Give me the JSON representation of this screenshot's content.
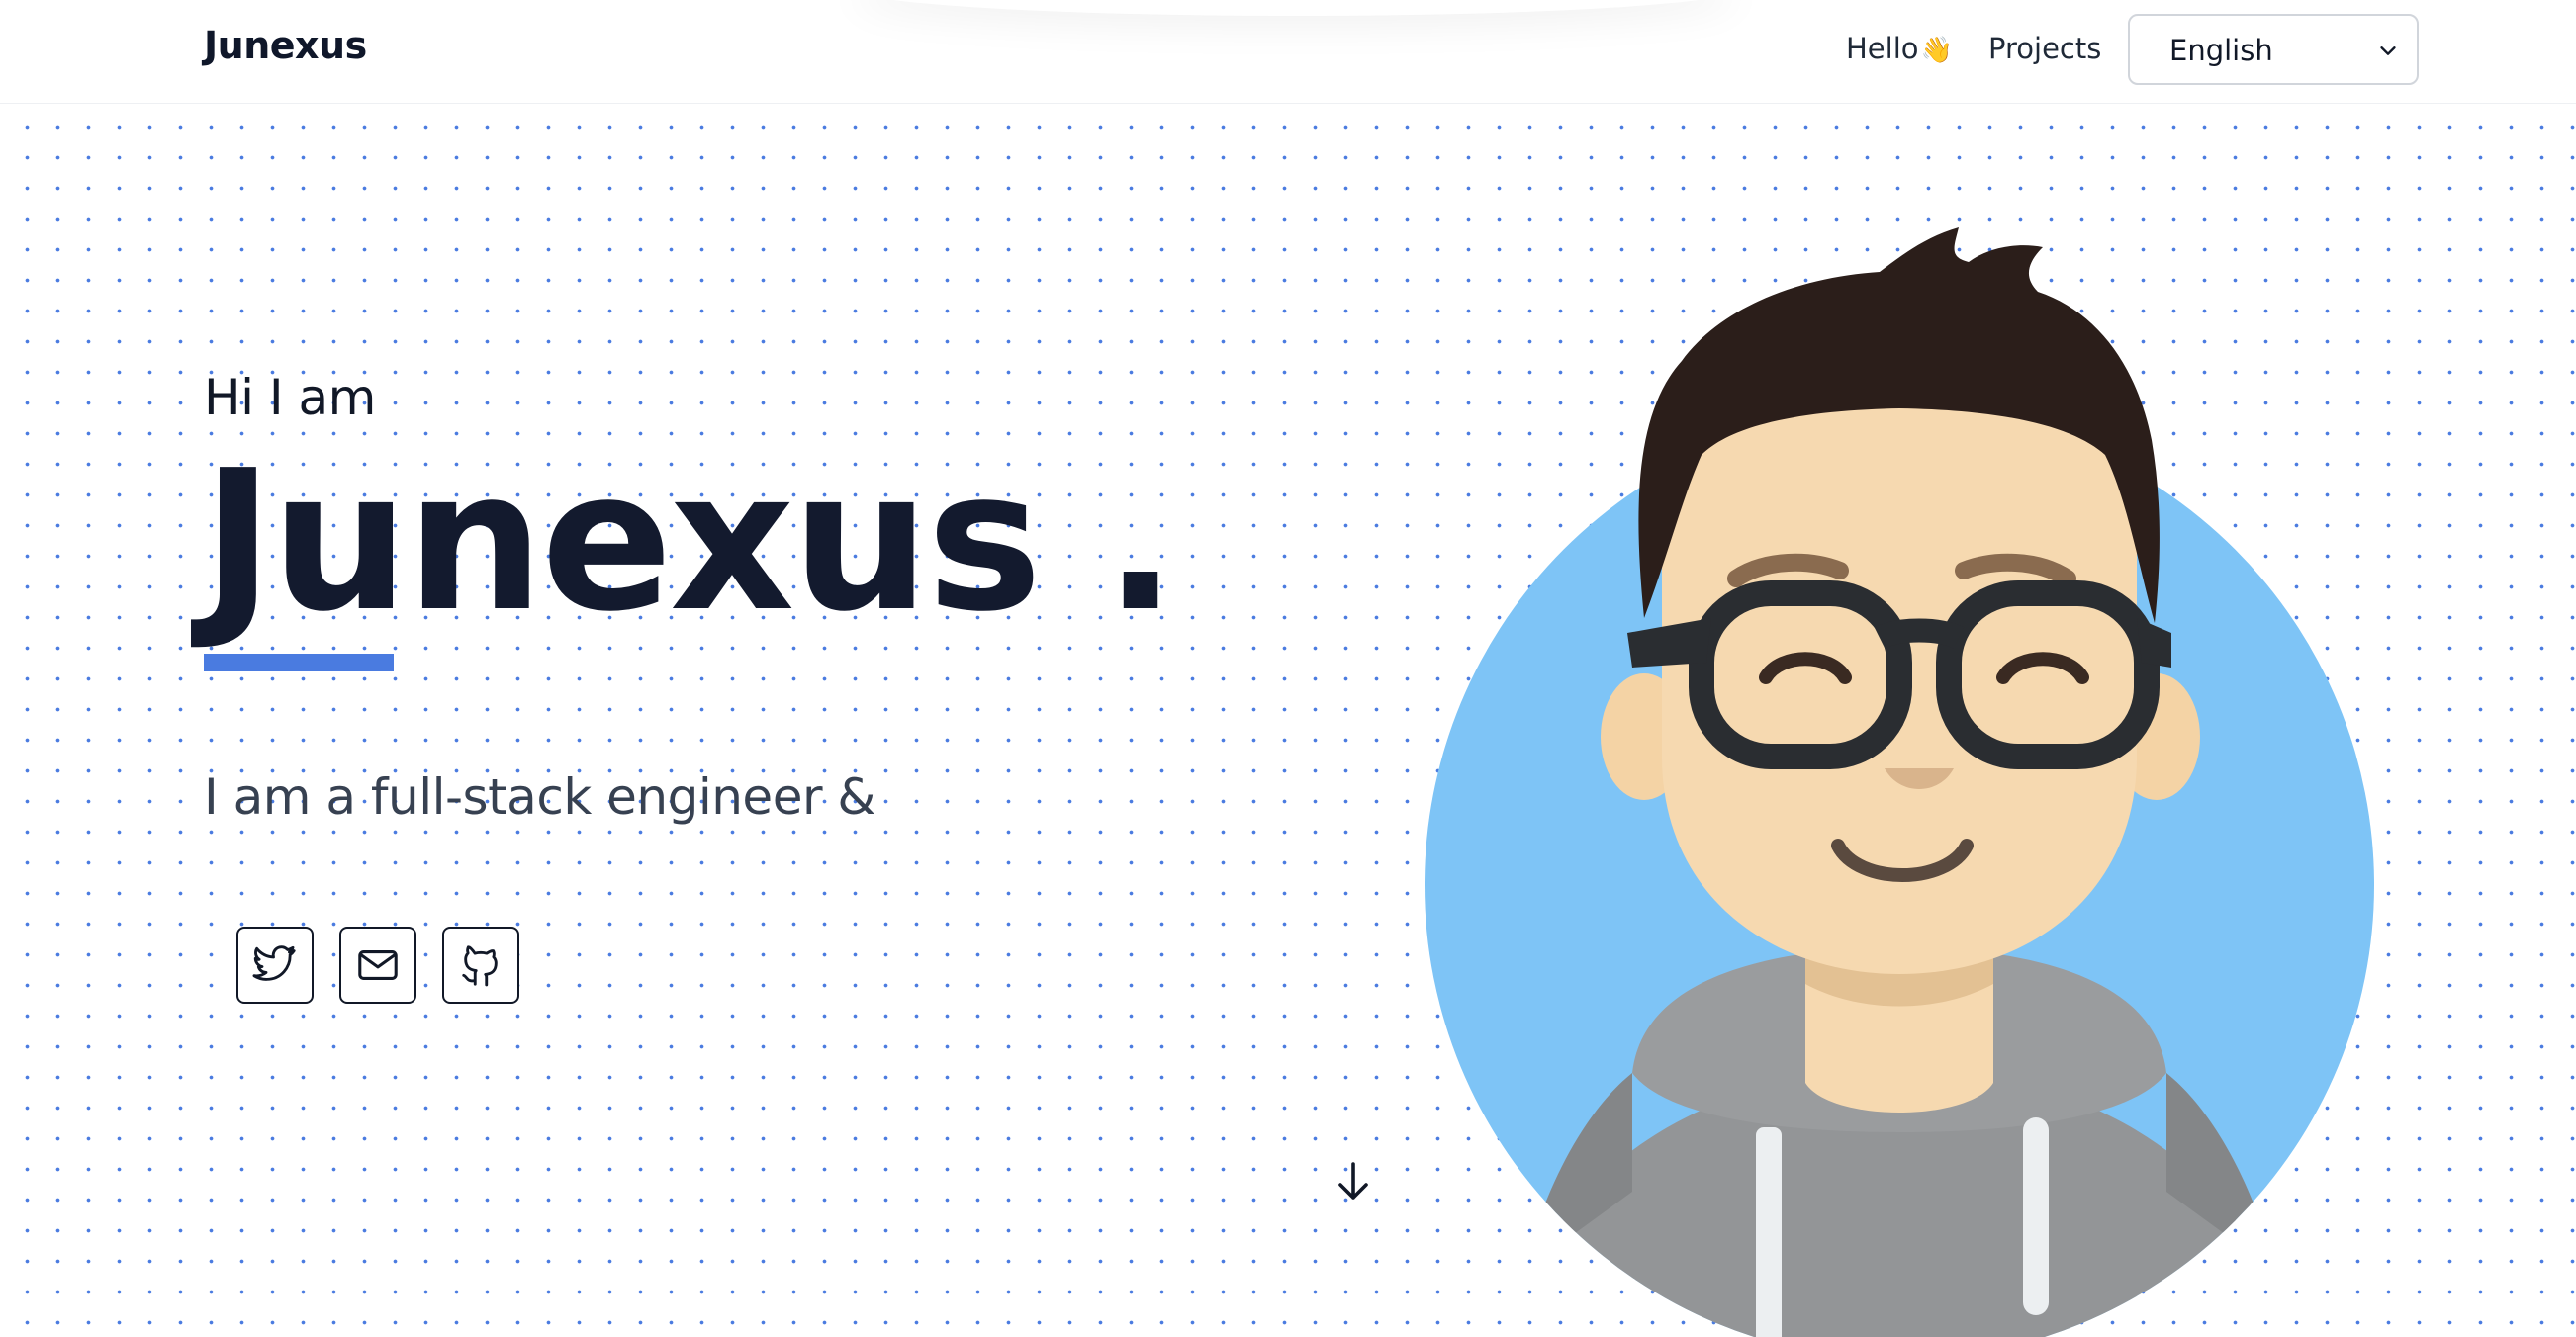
{
  "header": {
    "brand": "Junexus",
    "nav": {
      "hello": "Hello",
      "hello_emoji": "👋",
      "projects": "Projects"
    },
    "language_select": {
      "value": "English"
    }
  },
  "hero": {
    "greeting": "Hi I am",
    "name": "Junexus .",
    "tagline": "I am a full-stack engineer &",
    "social": [
      {
        "icon": "twitter-icon"
      },
      {
        "icon": "mail-icon"
      },
      {
        "icon": "github-icon"
      }
    ],
    "scroll_icon": "arrow-down-icon",
    "avatar_icon": "avatar-illustration"
  },
  "colors": {
    "accent": "#4a7be0",
    "text_dark": "#131a2e",
    "avatar_bg": "#7ec4f6",
    "skin": "#f6d9b0",
    "hair": "#2b1e1a",
    "hoodie": "#939597"
  }
}
